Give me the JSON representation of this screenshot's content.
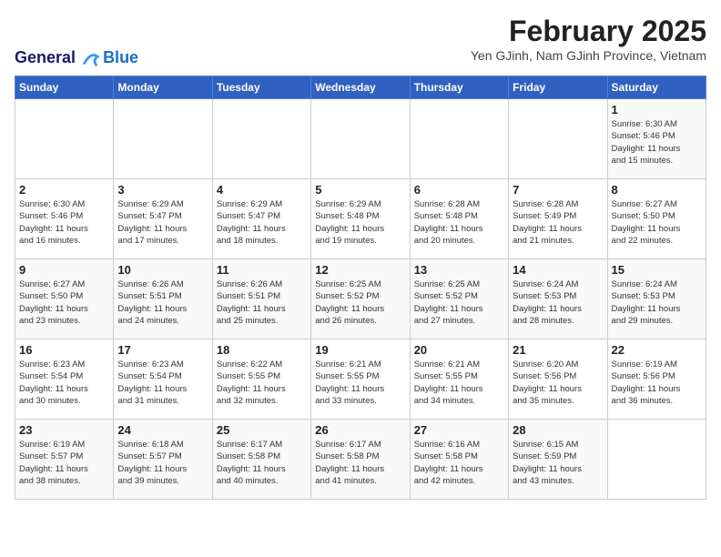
{
  "logo": {
    "line1": "General",
    "line2": "Blue"
  },
  "title": "February 2025",
  "subtitle": "Yen GJinh, Nam GJinh Province, Vietnam",
  "weekdays": [
    "Sunday",
    "Monday",
    "Tuesday",
    "Wednesday",
    "Thursday",
    "Friday",
    "Saturday"
  ],
  "weeks": [
    [
      {
        "day": "",
        "info": ""
      },
      {
        "day": "",
        "info": ""
      },
      {
        "day": "",
        "info": ""
      },
      {
        "day": "",
        "info": ""
      },
      {
        "day": "",
        "info": ""
      },
      {
        "day": "",
        "info": ""
      },
      {
        "day": "1",
        "info": "Sunrise: 6:30 AM\nSunset: 5:46 PM\nDaylight: 11 hours\nand 15 minutes."
      }
    ],
    [
      {
        "day": "2",
        "info": "Sunrise: 6:30 AM\nSunset: 5:46 PM\nDaylight: 11 hours\nand 16 minutes."
      },
      {
        "day": "3",
        "info": "Sunrise: 6:29 AM\nSunset: 5:47 PM\nDaylight: 11 hours\nand 17 minutes."
      },
      {
        "day": "4",
        "info": "Sunrise: 6:29 AM\nSunset: 5:47 PM\nDaylight: 11 hours\nand 18 minutes."
      },
      {
        "day": "5",
        "info": "Sunrise: 6:29 AM\nSunset: 5:48 PM\nDaylight: 11 hours\nand 19 minutes."
      },
      {
        "day": "6",
        "info": "Sunrise: 6:28 AM\nSunset: 5:48 PM\nDaylight: 11 hours\nand 20 minutes."
      },
      {
        "day": "7",
        "info": "Sunrise: 6:28 AM\nSunset: 5:49 PM\nDaylight: 11 hours\nand 21 minutes."
      },
      {
        "day": "8",
        "info": "Sunrise: 6:27 AM\nSunset: 5:50 PM\nDaylight: 11 hours\nand 22 minutes."
      }
    ],
    [
      {
        "day": "9",
        "info": "Sunrise: 6:27 AM\nSunset: 5:50 PM\nDaylight: 11 hours\nand 23 minutes."
      },
      {
        "day": "10",
        "info": "Sunrise: 6:26 AM\nSunset: 5:51 PM\nDaylight: 11 hours\nand 24 minutes."
      },
      {
        "day": "11",
        "info": "Sunrise: 6:26 AM\nSunset: 5:51 PM\nDaylight: 11 hours\nand 25 minutes."
      },
      {
        "day": "12",
        "info": "Sunrise: 6:25 AM\nSunset: 5:52 PM\nDaylight: 11 hours\nand 26 minutes."
      },
      {
        "day": "13",
        "info": "Sunrise: 6:25 AM\nSunset: 5:52 PM\nDaylight: 11 hours\nand 27 minutes."
      },
      {
        "day": "14",
        "info": "Sunrise: 6:24 AM\nSunset: 5:53 PM\nDaylight: 11 hours\nand 28 minutes."
      },
      {
        "day": "15",
        "info": "Sunrise: 6:24 AM\nSunset: 5:53 PM\nDaylight: 11 hours\nand 29 minutes."
      }
    ],
    [
      {
        "day": "16",
        "info": "Sunrise: 6:23 AM\nSunset: 5:54 PM\nDaylight: 11 hours\nand 30 minutes."
      },
      {
        "day": "17",
        "info": "Sunrise: 6:23 AM\nSunset: 5:54 PM\nDaylight: 11 hours\nand 31 minutes."
      },
      {
        "day": "18",
        "info": "Sunrise: 6:22 AM\nSunset: 5:55 PM\nDaylight: 11 hours\nand 32 minutes."
      },
      {
        "day": "19",
        "info": "Sunrise: 6:21 AM\nSunset: 5:55 PM\nDaylight: 11 hours\nand 33 minutes."
      },
      {
        "day": "20",
        "info": "Sunrise: 6:21 AM\nSunset: 5:55 PM\nDaylight: 11 hours\nand 34 minutes."
      },
      {
        "day": "21",
        "info": "Sunrise: 6:20 AM\nSunset: 5:56 PM\nDaylight: 11 hours\nand 35 minutes."
      },
      {
        "day": "22",
        "info": "Sunrise: 6:19 AM\nSunset: 5:56 PM\nDaylight: 11 hours\nand 36 minutes."
      }
    ],
    [
      {
        "day": "23",
        "info": "Sunrise: 6:19 AM\nSunset: 5:57 PM\nDaylight: 11 hours\nand 38 minutes."
      },
      {
        "day": "24",
        "info": "Sunrise: 6:18 AM\nSunset: 5:57 PM\nDaylight: 11 hours\nand 39 minutes."
      },
      {
        "day": "25",
        "info": "Sunrise: 6:17 AM\nSunset: 5:58 PM\nDaylight: 11 hours\nand 40 minutes."
      },
      {
        "day": "26",
        "info": "Sunrise: 6:17 AM\nSunset: 5:58 PM\nDaylight: 11 hours\nand 41 minutes."
      },
      {
        "day": "27",
        "info": "Sunrise: 6:16 AM\nSunset: 5:58 PM\nDaylight: 11 hours\nand 42 minutes."
      },
      {
        "day": "28",
        "info": "Sunrise: 6:15 AM\nSunset: 5:59 PM\nDaylight: 11 hours\nand 43 minutes."
      },
      {
        "day": "",
        "info": ""
      }
    ]
  ]
}
